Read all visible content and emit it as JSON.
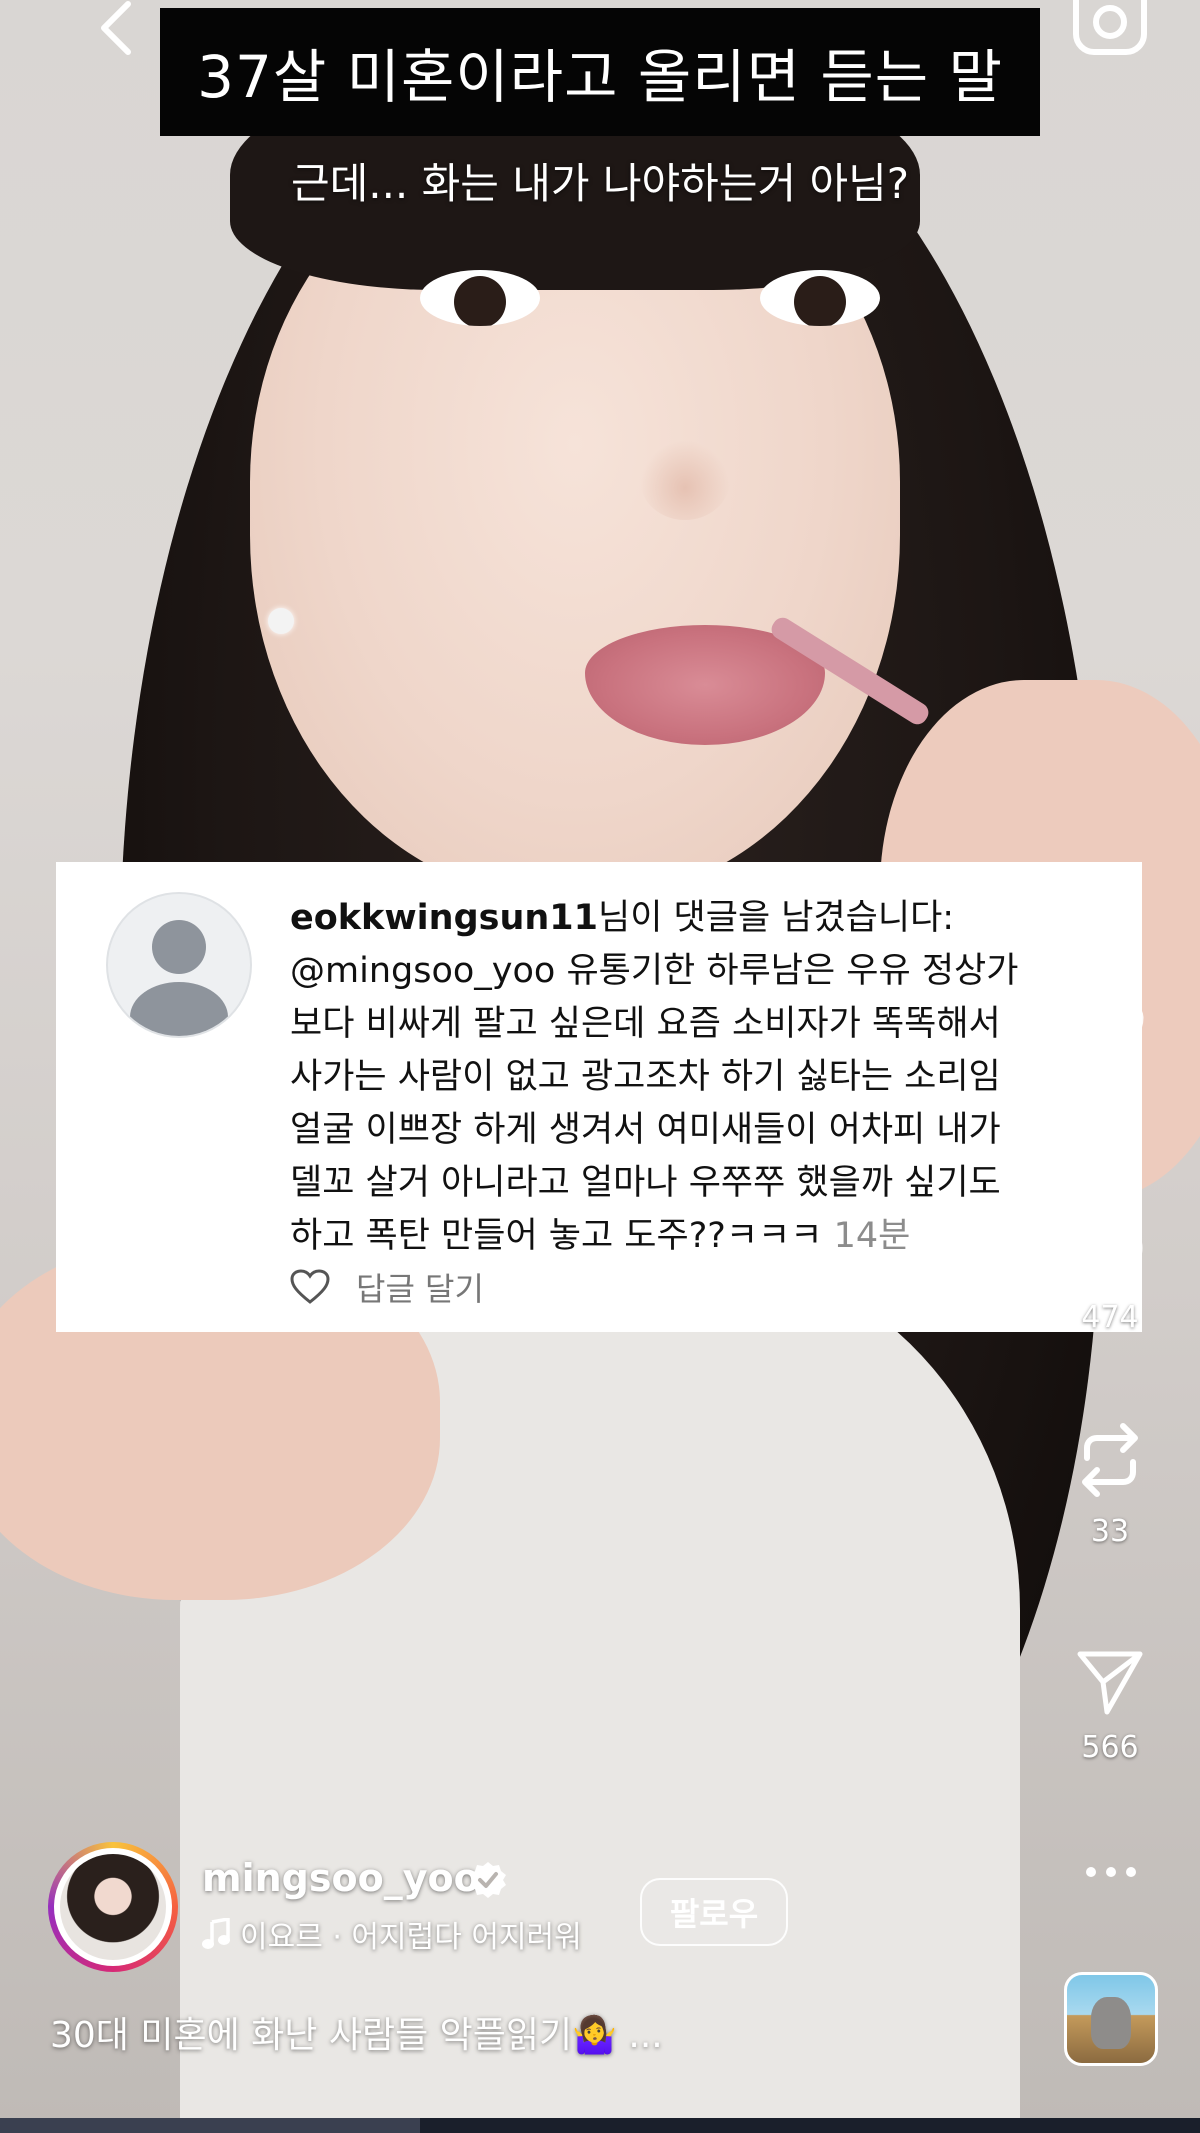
{
  "video": {
    "title_overlay": "37살 미혼이라고 올리면 듣는 말",
    "subtitle_overlay": "근데... 화는 내가 나야하는거 아님?"
  },
  "comment_card": {
    "username": "eokkwingsun11",
    "lines": [
      "님이 댓글을 남겼습니다:",
      "@mingsoo_yoo 유통기한 하루남은 우유 정상가",
      "보다 비싸게 팔고 싶은데 요즘 소비자가 똑똑해서",
      "사가는 사람이 없고 광고조차 하기 싫타는 소리임",
      "얼굴 이쁘장 하게 생겨서 여미새들이 어차피 내가",
      "델꼬 살거 아니라고 얼마나 우쭈쭈 했을까 싶기도",
      "하고 폭탄 만들어 놓고 도주??ㅋㅋㅋ"
    ],
    "time": "14분",
    "reply_label": "답글 달기"
  },
  "rail": {
    "comments_count": "474",
    "reposts_count": "33",
    "shares_count": "566"
  },
  "author": {
    "username": "mingsoo_yoo",
    "audio": "이요르 · 어지럽다 어지러워",
    "follow_label": "팔로우",
    "caption": "30대 미혼에 화난 사람들 악플읽기🤷‍♀️  ..."
  },
  "playback": {
    "progress": 0.35
  },
  "colors": {
    "card_bg": "#ffffff",
    "title_bg": "#050505",
    "muted_text": "#8c8c8c"
  },
  "icons": {
    "back": "chevron-left-icon",
    "camera": "camera-icon",
    "like": "heart-icon",
    "comment": "comment-bubble-icon",
    "repost": "repost-icon",
    "share": "send-icon",
    "more": "more-dots-icon",
    "verified": "verified-badge-icon",
    "music": "music-note-icon"
  }
}
